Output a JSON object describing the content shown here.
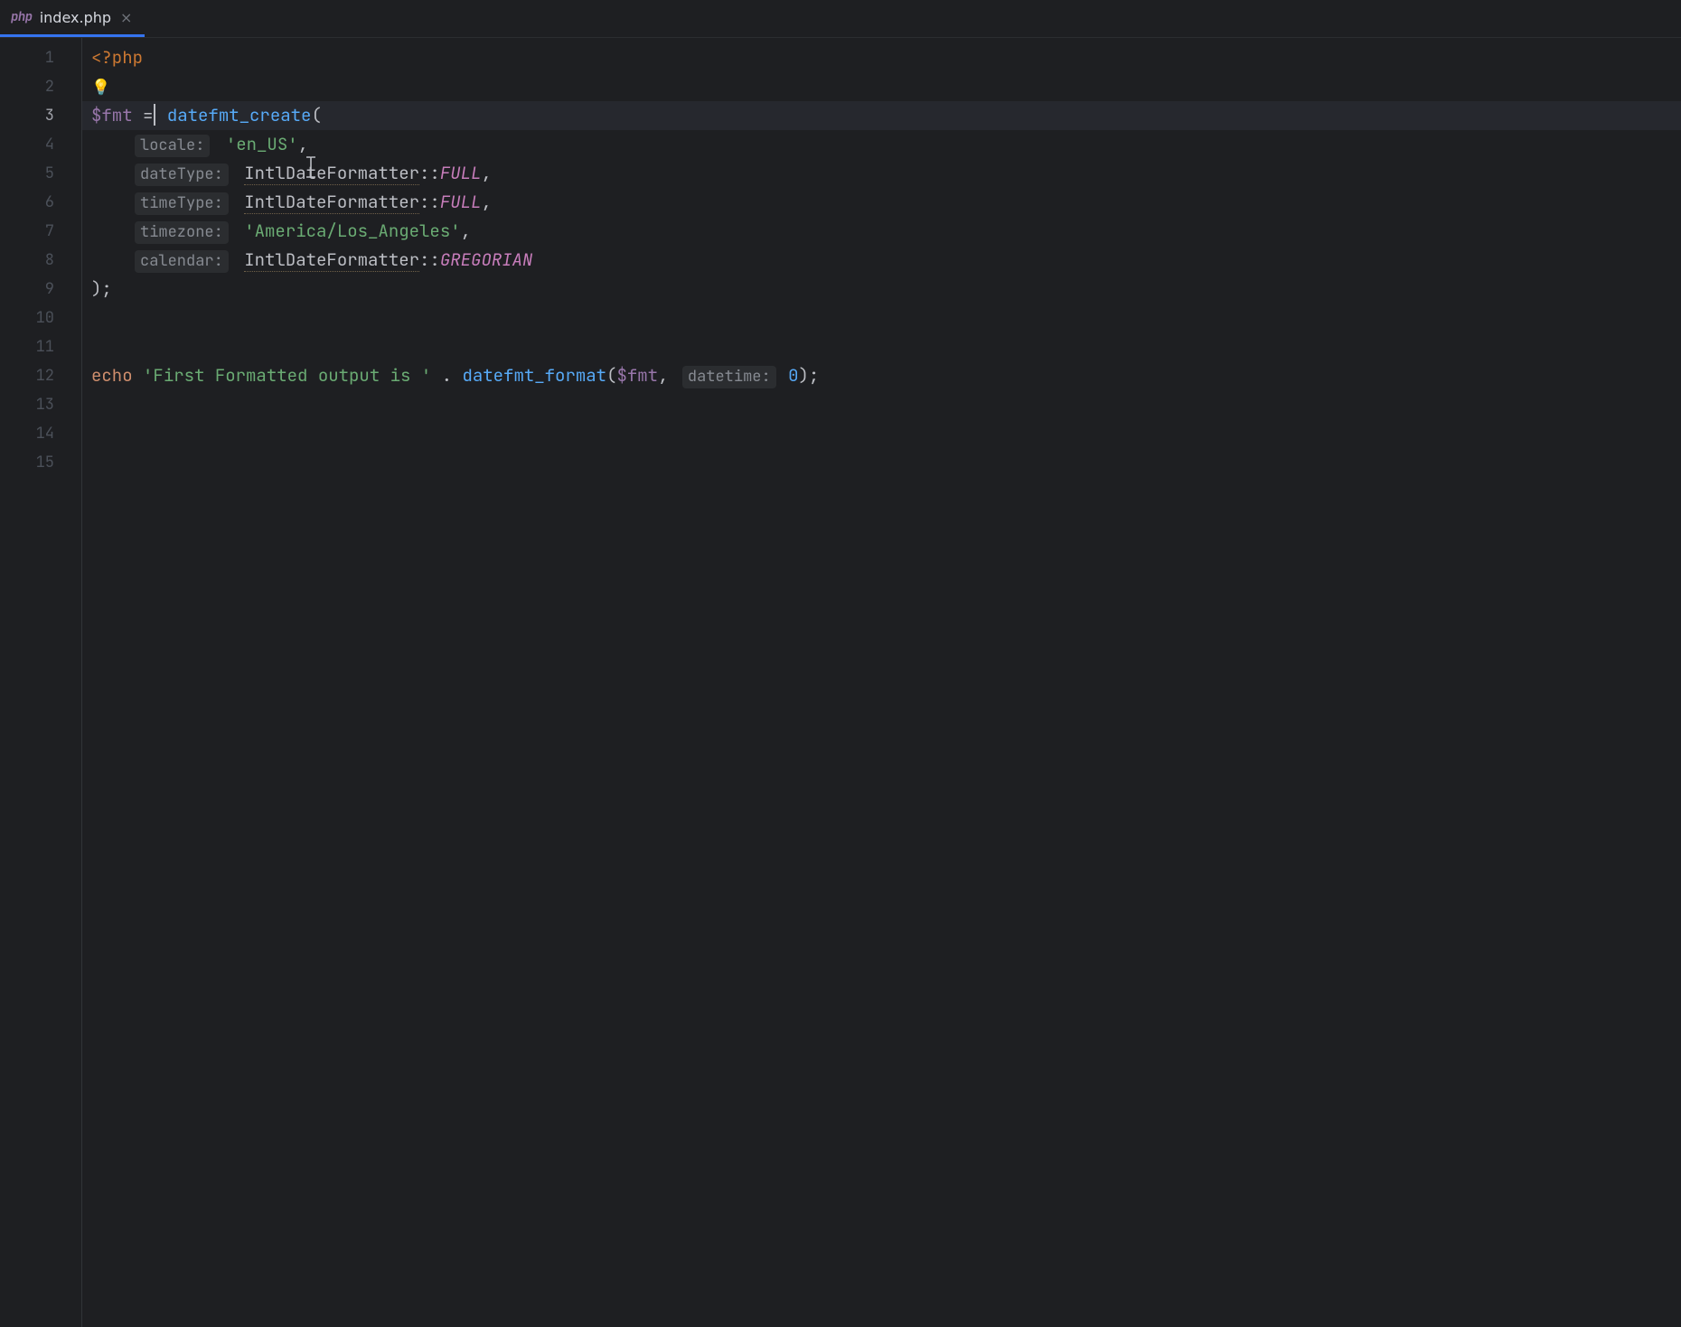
{
  "tab": {
    "icon_label": "php",
    "title": "index.php",
    "close": "×"
  },
  "gutter": {
    "lines": [
      "1",
      "2",
      "3",
      "4",
      "5",
      "6",
      "7",
      "8",
      "9",
      "10",
      "11",
      "12",
      "13",
      "14",
      "15"
    ],
    "active_line_index": 2
  },
  "code": {
    "l1": {
      "open": "<?php"
    },
    "l2": {
      "bulb": "💡"
    },
    "l3": {
      "var": "$fmt",
      "sp1": " ",
      "eq": "=",
      "sp2": " ",
      "fn": "datefmt_create",
      "lp": "("
    },
    "l4": {
      "inlay": "locale:",
      "sp": " ",
      "str": "'en_US'",
      "comma": ","
    },
    "l5": {
      "inlay": "dateType:",
      "sp": " ",
      "cls": "IntlDateFormatter",
      "cc": "::",
      "cst": "FULL",
      "comma": ","
    },
    "l6": {
      "inlay": "timeType:",
      "sp": " ",
      "cls": "IntlDateFormatter",
      "cc": "::",
      "cst": "FULL",
      "comma": ","
    },
    "l7": {
      "inlay": "timezone:",
      "sp": " ",
      "str": "'America/Los_Angeles'",
      "comma": ","
    },
    "l8": {
      "inlay": "calendar:",
      "sp": " ",
      "cls": "IntlDateFormatter",
      "cc": "::",
      "cst": "GREGORIAN"
    },
    "l9": {
      "close": ");"
    },
    "l12": {
      "kw": "echo",
      "sp1": " ",
      "str": "'First Formatted output is '",
      "sp2": " ",
      "dot": ".",
      "sp3": " ",
      "fn": "datefmt_format",
      "lp": "(",
      "var": "$fmt",
      "comma": ",",
      "sp4": " ",
      "inlay": "datetime:",
      "sp5": " ",
      "num": "0",
      "rp": ")",
      "semi": ";"
    }
  }
}
